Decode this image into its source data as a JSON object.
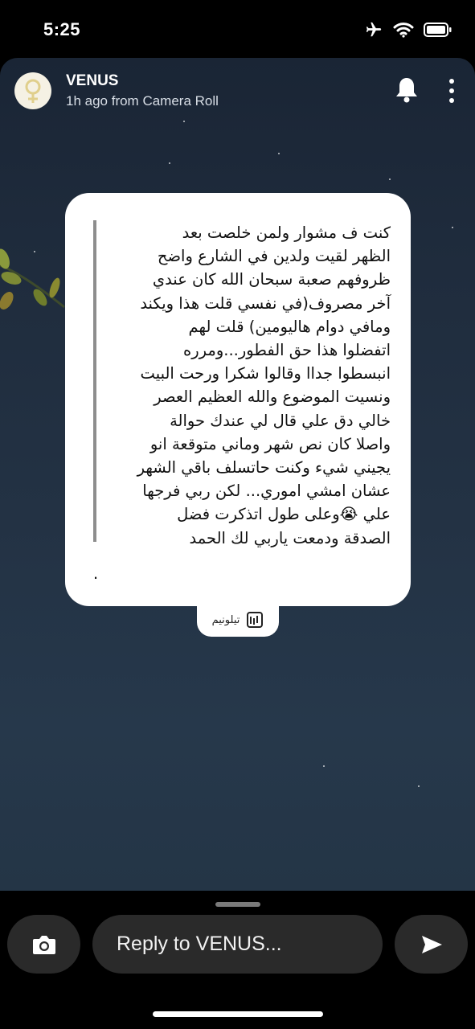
{
  "status_bar": {
    "time": "5:25",
    "icons": [
      "airplane-icon",
      "wifi-icon",
      "battery-icon"
    ]
  },
  "story": {
    "user": "VENUS",
    "meta": "1h ago from Camera Roll",
    "avatar_icon": "venus-symbol-icon",
    "text_lines": [
      "كنت ف مشوار ولمن خلصت بعد",
      "الظهر لقيت ولدين في الشارع واضح",
      "ظروفهم صعبة سبحان الله كان عندي",
      "آخر مصروف(في نفسي قلت هذا ويكند",
      "ومافي دوام هاليومين) قلت لهم",
      "اتفضلوا هذا حق الفطور...ومرره",
      "انبسطوا جداا وقالوا شكرا ورحت البيت",
      "ونسيت الموضوع والله العظيم العصر",
      "خالي دق علي قال لي عندك حوالة",
      "واصلا كان نص شهر وماني متوقعة انو",
      "يجيني شيء وكنت حاتسلف باقي الشهر",
      "عشان امشي اموري... لكن ربي فرجها",
      "علي 😭وعلى طول اتذكرت فضل",
      "الصدقة ودمعت ياربي لك الحمد"
    ],
    "trailing_mark": ".",
    "sticker_label": "تيلونيم"
  },
  "reply": {
    "placeholder": "Reply to VENUS..."
  },
  "colors": {
    "card_bg": "#ffffff",
    "story_bg": "#1f2c3d",
    "bar_bg": "#2a2a2a"
  }
}
